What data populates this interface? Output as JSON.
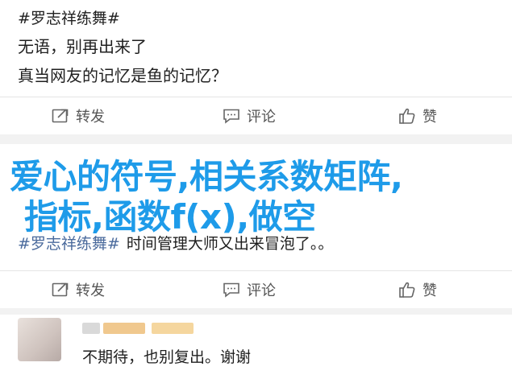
{
  "post1": {
    "topic": "#罗志祥练舞#",
    "line1": "无语，别再出来了",
    "line2": "真当网友的记忆是鱼的记忆？"
  },
  "actions": {
    "repost_label": "转发",
    "comment_label": "评论",
    "like_label": "赞"
  },
  "overlay": {
    "line1": "爱心的符号,相关系数矩阵,",
    "line2": "指标,函数f(x),做空"
  },
  "post2": {
    "topic": "#罗志祥练舞#",
    "text": "时间管理大师又出来冒泡了。。"
  },
  "comment": {
    "text": "不期待，也别复出。谢谢"
  },
  "colors": {
    "topic": "#4a6a9c",
    "overlay_text": "#1e9be9",
    "action_text": "#555555"
  }
}
